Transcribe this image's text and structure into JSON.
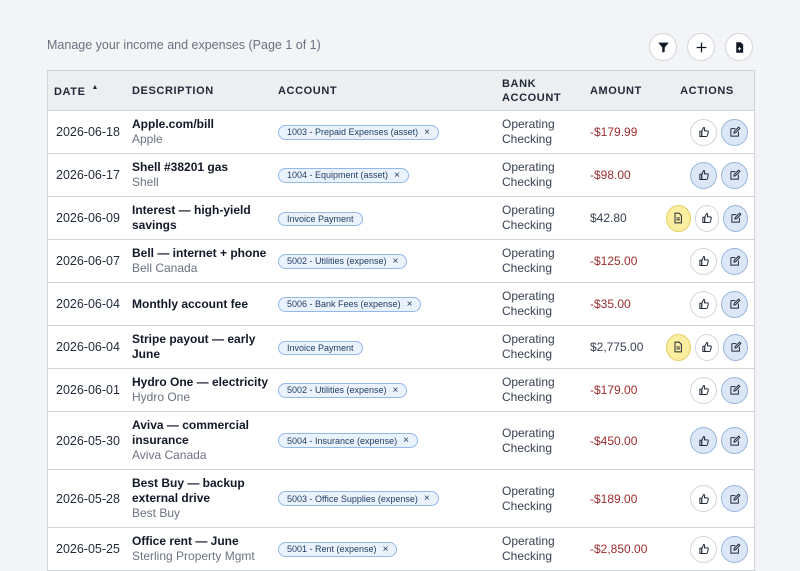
{
  "header": {
    "subtitle": "Manage your income and expenses (Page 1 of 1)",
    "toolbar": [
      {
        "icon": "filter-icon",
        "name": "filter-button"
      },
      {
        "icon": "plus-icon",
        "name": "add-transaction-button"
      },
      {
        "icon": "document-export-icon",
        "name": "export-button"
      }
    ]
  },
  "table": {
    "columns": {
      "date": "DATE",
      "description": "DESCRIPTION",
      "account": "ACCOUNT",
      "bank_account": "BANK ACCOUNT",
      "amount": "AMOUNT",
      "actions": "ACTIONS"
    },
    "sort_indicator": "▲",
    "rows": [
      {
        "date": "2026-06-18",
        "title": "Apple.com/bill",
        "sub": "Apple",
        "account": "1003 - Prepaid Expenses (asset)",
        "removable": true,
        "bank": "Operating Checking",
        "amount": "-$179.99",
        "negative": true,
        "doc": false,
        "liked": false
      },
      {
        "date": "2026-06-17",
        "title": "Shell #38201 gas",
        "sub": "Shell",
        "account": "1004 - Equipment (asset)",
        "removable": true,
        "bank": "Operating Checking",
        "amount": "-$98.00",
        "negative": true,
        "doc": false,
        "liked": true
      },
      {
        "date": "2026-06-09",
        "title": "Interest — high-yield savings",
        "sub": "",
        "account": "Invoice Payment",
        "removable": false,
        "bank": "Operating Checking",
        "amount": "$42.80",
        "negative": false,
        "doc": true,
        "liked": false
      },
      {
        "date": "2026-06-07",
        "title": "Bell — internet + phone",
        "sub": "Bell Canada",
        "account": "5002 - Utilities (expense)",
        "removable": true,
        "bank": "Operating Checking",
        "amount": "-$125.00",
        "negative": true,
        "doc": false,
        "liked": false
      },
      {
        "date": "2026-06-04",
        "title": "Monthly account fee",
        "sub": "",
        "account": "5006 - Bank Fees (expense)",
        "removable": true,
        "bank": "Operating Checking",
        "amount": "-$35.00",
        "negative": true,
        "doc": false,
        "liked": false
      },
      {
        "date": "2026-06-04",
        "title": "Stripe payout — early June",
        "sub": "",
        "account": "Invoice Payment",
        "removable": false,
        "bank": "Operating Checking",
        "amount": "$2,775.00",
        "negative": false,
        "doc": true,
        "liked": false
      },
      {
        "date": "2026-06-01",
        "title": "Hydro One — electricity",
        "sub": "Hydro One",
        "account": "5002 - Utilities (expense)",
        "removable": true,
        "bank": "Operating Checking",
        "amount": "-$179.00",
        "negative": true,
        "doc": false,
        "liked": false
      },
      {
        "date": "2026-05-30",
        "title": "Aviva — commercial insurance",
        "sub": "Aviva Canada",
        "account": "5004 - Insurance (expense)",
        "removable": true,
        "bank": "Operating Checking",
        "amount": "-$450.00",
        "negative": true,
        "doc": false,
        "liked": true
      },
      {
        "date": "2026-05-28",
        "title": "Best Buy — backup external drive",
        "sub": "Best Buy",
        "account": "5003 - Office Supplies (expense)",
        "removable": true,
        "bank": "Operating Checking",
        "amount": "-$189.00",
        "negative": true,
        "doc": false,
        "liked": false
      },
      {
        "date": "2026-05-25",
        "title": "Office rent — June",
        "sub": "Sterling Property Mgmt",
        "account": "5001 - Rent (expense)",
        "removable": true,
        "bank": "Operating Checking",
        "amount": "-$2,850.00",
        "negative": true,
        "doc": false,
        "liked": false
      }
    ]
  },
  "labels": {
    "remove": "×"
  },
  "colors": {
    "negative_amount": "#9b2c2c",
    "chip_bg": "#eaf2fd",
    "chip_border": "#93b8ea",
    "active_button": "#dbe6f7",
    "doc_button": "#fbeea0"
  }
}
